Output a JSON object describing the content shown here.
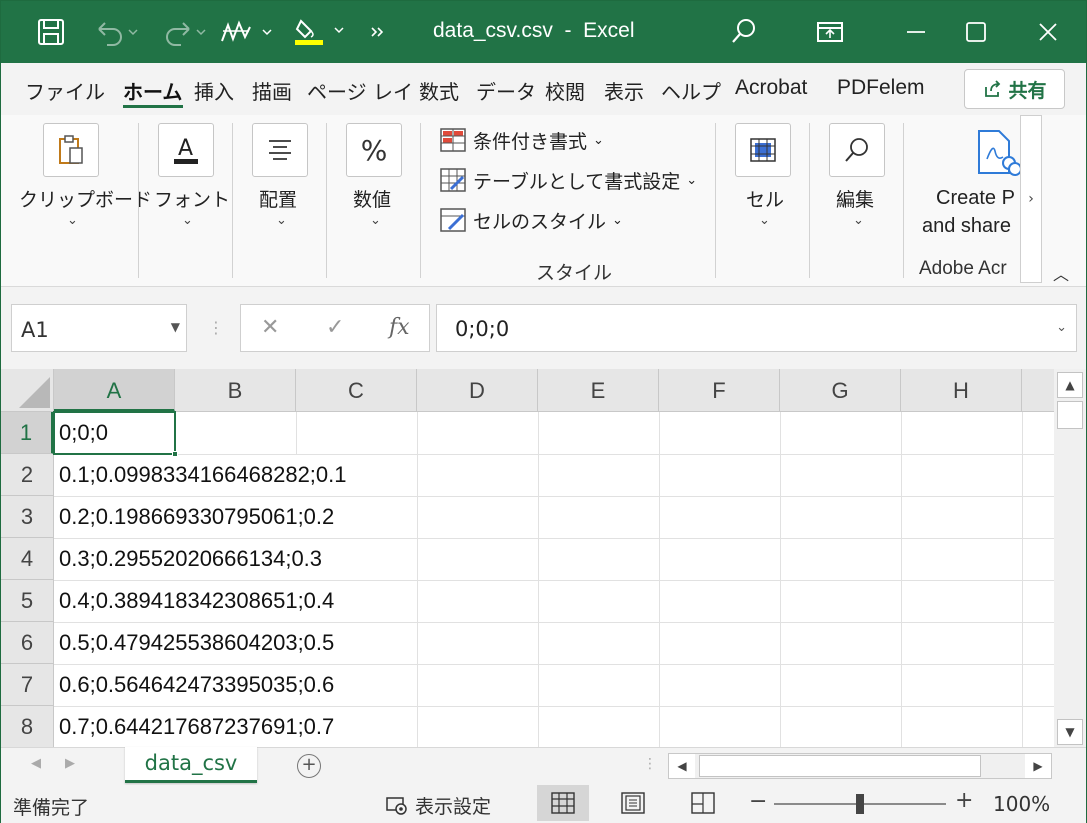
{
  "window": {
    "title": "data_csv.csv  -  Excel"
  },
  "ribbon_tabs": [
    {
      "label": "ファイル",
      "active": false
    },
    {
      "label": "ホーム",
      "active": true
    },
    {
      "label": "挿入",
      "active": false
    },
    {
      "label": "描画",
      "active": false
    },
    {
      "label": "ページ レイ",
      "active": false
    },
    {
      "label": "数式",
      "active": false
    },
    {
      "label": "データ",
      "active": false
    },
    {
      "label": "校閲",
      "active": false
    },
    {
      "label": "表示",
      "active": false
    },
    {
      "label": "ヘルプ",
      "active": false
    },
    {
      "label": "Acrobat",
      "active": false
    },
    {
      "label": "PDFelem",
      "active": false
    }
  ],
  "share_button": {
    "label": "共有"
  },
  "ribbon": {
    "clipboard": "クリップボード",
    "font": "フォント",
    "alignment": "配置",
    "number": "数値",
    "conditional_format": "条件付き書式",
    "format_as_table": "テーブルとして書式設定",
    "cell_styles": "セルのスタイル",
    "styles_group": "スタイル",
    "cells": "セル",
    "editing": "編集",
    "create_pdf_line1": "Create P",
    "create_pdf_line2": "and share",
    "adobe_group": "Adobe Acr"
  },
  "formula_bar": {
    "name_box": "A1",
    "fx": "fx",
    "value": "0;0;0"
  },
  "columns": [
    "A",
    "B",
    "C",
    "D",
    "E",
    "F",
    "G",
    "H"
  ],
  "rows": [
    {
      "num": "1",
      "a": "0;0;0"
    },
    {
      "num": "2",
      "a": "0.1;0.0998334166468282;0.1"
    },
    {
      "num": "3",
      "a": "0.2;0.198669330795061;0.2"
    },
    {
      "num": "4",
      "a": "0.3;0.29552020666134;0.3"
    },
    {
      "num": "5",
      "a": "0.4;0.389418342308651;0.4"
    },
    {
      "num": "6",
      "a": "0.5;0.479425538604203;0.5"
    },
    {
      "num": "7",
      "a": "0.6;0.564642473395035;0.6"
    },
    {
      "num": "8",
      "a": "0.7;0.644217687237691;0.7"
    }
  ],
  "sheet_tab": "data_csv",
  "status": {
    "ready": "準備完了",
    "display_settings": "表示設定",
    "zoom": "100%"
  },
  "colors": {
    "accent": "#217346"
  }
}
